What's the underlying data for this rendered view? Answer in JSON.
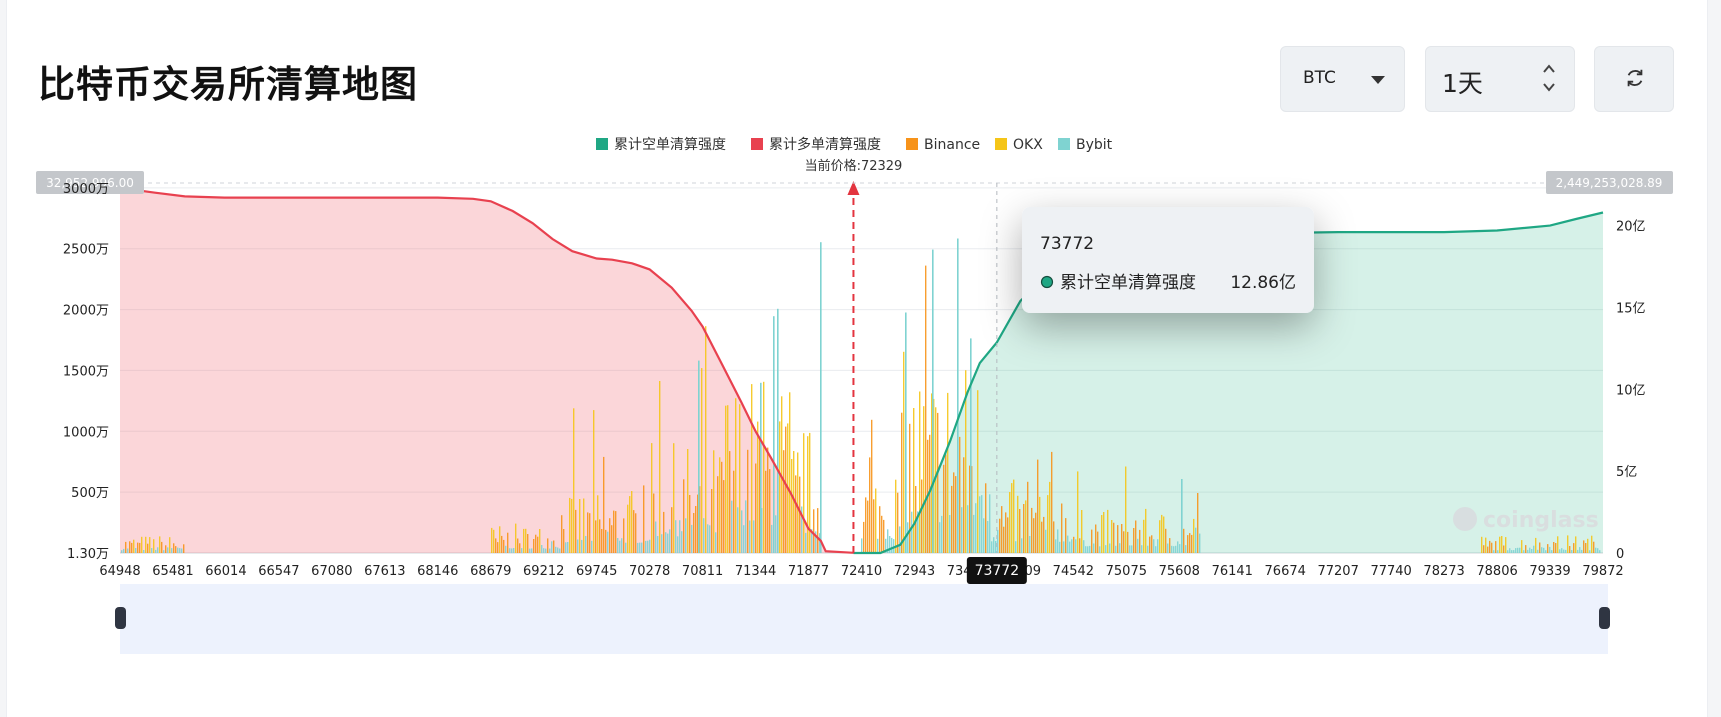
{
  "page": {
    "title": "比特币交易所清算地图"
  },
  "controls": {
    "symbol": "BTC",
    "period": "1天"
  },
  "colors": {
    "short": "#1fa784",
    "long": "#e8414f",
    "binance": "#f7931a",
    "okx": "#f5c518",
    "bybit": "#7fd3d1"
  },
  "chart_data": {
    "type": "line",
    "legend": [
      "累计空单清算强度",
      "累计多单清算强度",
      "Binance",
      "OKX",
      "Bybit"
    ],
    "current_price_label": "当前价格:72329",
    "current_price": 72329,
    "x_ticks": [
      "64948",
      "65481",
      "66014",
      "66547",
      "67080",
      "67613",
      "68146",
      "68679",
      "69212",
      "69745",
      "70278",
      "70811",
      "71344",
      "71877",
      "72410",
      "72943",
      "73476",
      "74009",
      "74542",
      "75075",
      "75608",
      "76141",
      "76674",
      "77207",
      "77740",
      "78273",
      "78806",
      "79339",
      "79872"
    ],
    "left_axis_ticks": [
      "3000万",
      "2500万",
      "2000万",
      "1500万",
      "1000万",
      "500万",
      "1.30万"
    ],
    "right_axis_ticks": [
      "20亿",
      "15亿",
      "10亿",
      "5亿",
      "0"
    ],
    "left_max_label": "32,952,996.00",
    "right_max_label": "2,449,253,028.89",
    "series": [
      {
        "name": "累计多单清算强度",
        "unit": "万",
        "x": [
          64948,
          65300,
          65600,
          66000,
          66547,
          67080,
          67613,
          68146,
          68500,
          68679,
          68900,
          69100,
          69300,
          69500,
          69745,
          69900,
          70100,
          70278,
          70500,
          70700,
          70811,
          71000,
          71200,
          71344,
          71500,
          71700,
          71877,
          72000,
          72050,
          72329
        ],
        "y": [
          3000,
          2960,
          2930,
          2920,
          2920,
          2920,
          2920,
          2920,
          2910,
          2890,
          2810,
          2710,
          2580,
          2480,
          2420,
          2410,
          2380,
          2330,
          2180,
          1990,
          1860,
          1560,
          1240,
          1000,
          780,
          490,
          200,
          100,
          15,
          1.3
        ]
      },
      {
        "name": "累计空单清算强度",
        "unit": "亿",
        "x": [
          72329,
          72600,
          72800,
          72943,
          73100,
          73300,
          73476,
          73600,
          73772,
          74009,
          74200,
          74542,
          75075,
          75608,
          76141,
          76674,
          77207,
          77740,
          78273,
          78806,
          79339,
          79600,
          79872
        ],
        "y": [
          0,
          0,
          0.5,
          1.8,
          3.8,
          6.8,
          9.8,
          11.6,
          12.86,
          15.4,
          16.5,
          17.4,
          18.4,
          19.0,
          19.4,
          19.55,
          19.6,
          19.6,
          19.6,
          19.7,
          20.0,
          20.4,
          20.8
        ]
      }
    ],
    "tooltip": {
      "price": "73772",
      "series": "累计空单清算强度",
      "value": "12.86亿"
    }
  }
}
